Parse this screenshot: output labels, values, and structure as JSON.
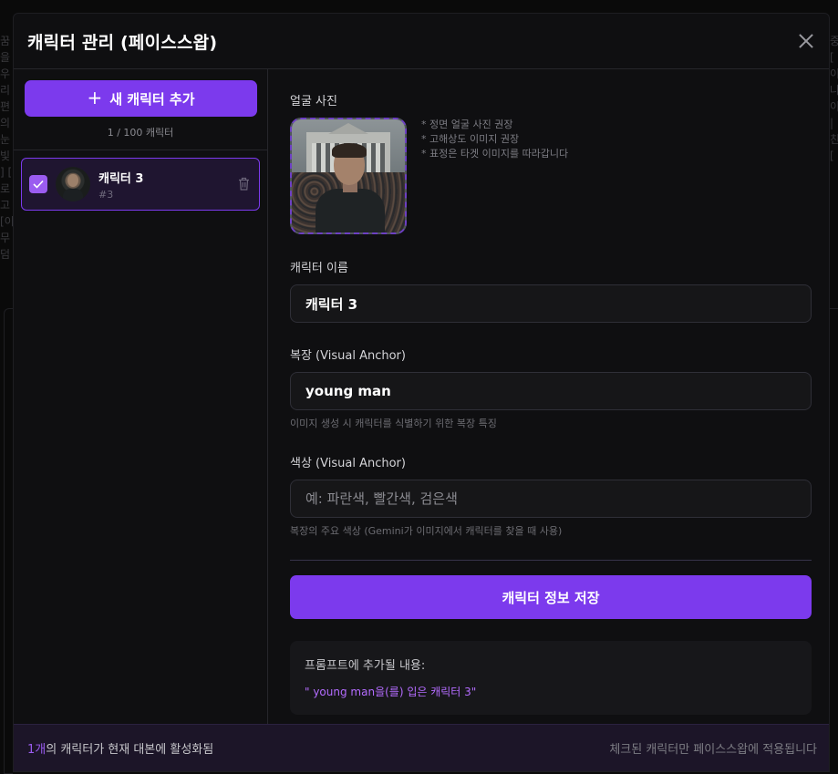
{
  "background": {
    "left_lines": [
      "꿈을",
      "우리",
      "편의",
      "눈빛",
      "] [",
      "로고",
      "[이",
      "무덤"
    ],
    "right_lines": [
      "중",
      "[",
      "이",
      "나",
      "이",
      "|",
      "친",
      "["
    ]
  },
  "modal": {
    "title": "캐릭터 관리 (페이스스왑)",
    "close_icon": "close-icon"
  },
  "sidebar": {
    "add_button": {
      "icon": "+",
      "label": "새 캐릭터 추가"
    },
    "count_text": "1 / 100 캐릭터",
    "items": [
      {
        "checked": true,
        "name": "캐릭터 3",
        "number": "#3"
      }
    ]
  },
  "form": {
    "photo_label": "얼굴 사진",
    "photo_hints": [
      "* 정면 얼굴 사진 권장",
      "* 고해상도 이미지 권장",
      "* 표정은 타겟 이미지를 따라갑니다"
    ],
    "name_label": "캐릭터 이름",
    "name_value": "캐릭터 3",
    "outfit_label": "복장 (Visual Anchor)",
    "outfit_value": "young man",
    "outfit_helper": "이미지 생성 시 캐릭터를 식별하기 위한 복장 특징",
    "color_label": "색상 (Visual Anchor)",
    "color_value": "",
    "color_placeholder": "예: 파란색, 빨간색, 검은색",
    "color_helper": "복장의 주요 색상 (Gemini가 이미지에서 캐릭터를 찾을 때 사용)",
    "save_button": "캐릭터 정보 저장",
    "preview_label": "프롬프트에 추가될 내용:",
    "preview_text": "\" young man을(를) 입은 캐릭터 3\""
  },
  "footer": {
    "active_count": "1개",
    "active_text": "의 캐릭터가 현재 대본에 활성화됨",
    "right_text": "체크된 캐릭터만 페이스스왑에 적용됩니다"
  },
  "colors": {
    "accent": "#7c3aed",
    "accent_text": "#b46cff",
    "background": "#0f0f11"
  }
}
